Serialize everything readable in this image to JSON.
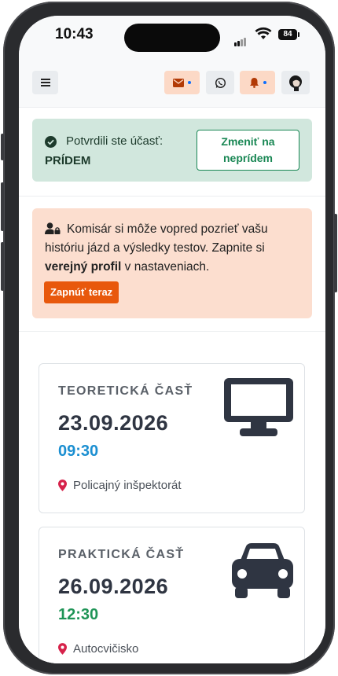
{
  "status_bar": {
    "time": "10:43",
    "battery": "84"
  },
  "colors": {
    "success_bg": "#d1e7dd",
    "success": "#198754",
    "warning_bg": "#fcdecf",
    "accent_orange": "#e8580c",
    "time_blue": "#1b8fd1",
    "time_green": "#1e9456",
    "pin_red": "#d6224a"
  },
  "topnav": {
    "icons": [
      "menu-icon",
      "mail-icon",
      "whatsapp-icon",
      "bell-icon",
      "avatar"
    ]
  },
  "attendance_alert": {
    "text": "Potvrdili ste účasť:",
    "status": "PRÍDEM",
    "button_line1": "Zmeniť na",
    "button_line2": "neprídem"
  },
  "profile_alert": {
    "text_pre": "Komisár si môže vopred pozrieť vašu históriu jázd a výsledky testov. Zapnite si ",
    "text_bold": "verejný profil",
    "text_post": " v nastaveniach.",
    "button": "Zapnúť teraz"
  },
  "exams": [
    {
      "label": "TEORETICKÁ ČASŤ",
      "date": "23.09.2026",
      "time": "09:30",
      "location": "Policajný inšpektorát",
      "icon": "monitor-icon"
    },
    {
      "label": "PRAKTICKÁ ČASŤ",
      "date": "26.09.2026",
      "time": "12:30",
      "location": "Autocvičisko",
      "icon": "car-icon"
    }
  ]
}
